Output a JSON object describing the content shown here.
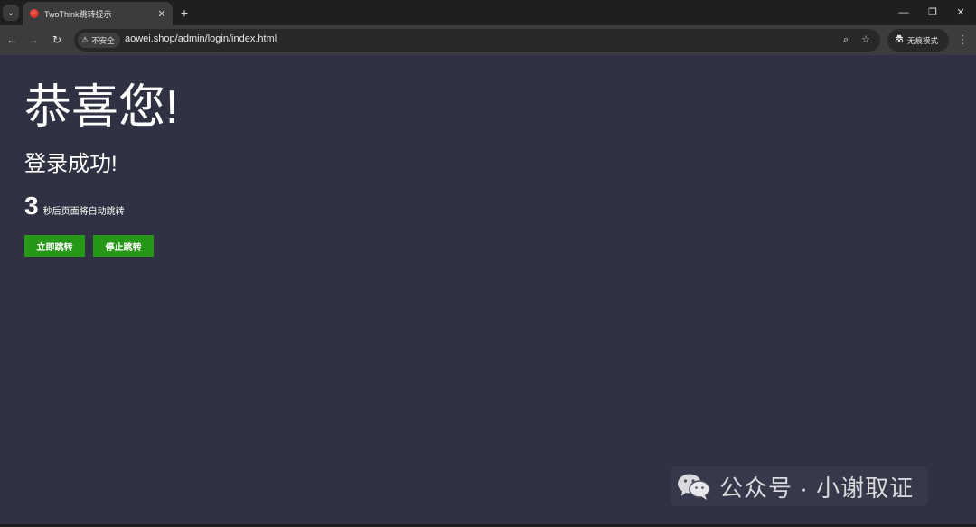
{
  "browser": {
    "tab_title": "TwoThink跳转提示",
    "tab_close": "✕",
    "new_tab": "+",
    "security_label": "不安全",
    "url": "aowei.shop/admin/login/index.html",
    "incognito_label": "无痕模式",
    "controls": {
      "minimize": "—",
      "restore": "❐",
      "close": "✕",
      "back": "←",
      "forward": "→",
      "reload": "↻",
      "zoom": "⌕",
      "bookmark": "☆",
      "menu": "⋮",
      "tab_search": "⌄"
    }
  },
  "page": {
    "heading": "恭喜您!",
    "message": "登录成功!",
    "countdown_seconds": "3",
    "countdown_text": "秒后页面将自动跳转",
    "jump_now_label": "立即跳转",
    "stop_jump_label": "停止跳转",
    "button_color": "#279718",
    "background_color": "#303142"
  },
  "watermark": {
    "text": "公众号 · 小谢取证"
  }
}
